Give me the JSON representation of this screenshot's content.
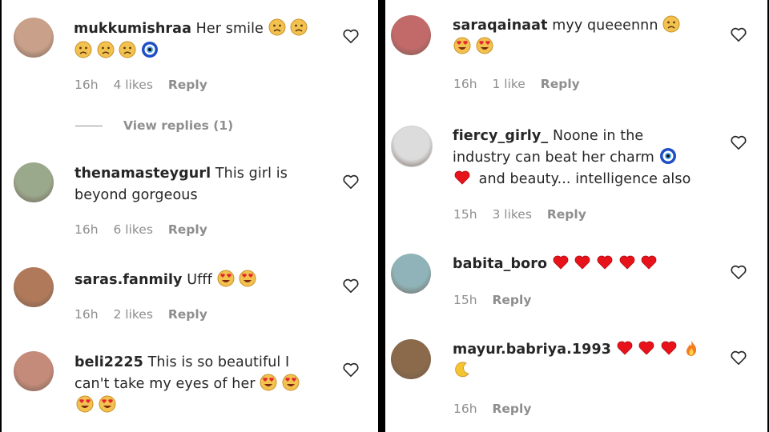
{
  "left": [
    {
      "username": "mukkumishraa",
      "text": "Her smile",
      "emojis_line1": [
        "sad-face",
        "sad-face"
      ],
      "emojis_line2": [
        "sad-face",
        "sad-face",
        "sad-face",
        "nazar-amulet"
      ],
      "time": "16h",
      "likes": "4 likes",
      "reply": "Reply",
      "view_replies": "View replies (1)",
      "avatar_color": "#c9a08a"
    },
    {
      "username": "thenamasteygurl",
      "text_line1": "This girl is",
      "text_line2": "beyond gorgeous",
      "time": "16h",
      "likes": "6 likes",
      "reply": "Reply",
      "avatar_color": "#9aa88c"
    },
    {
      "username": "saras.fanmily",
      "text": "Ufff",
      "emojis": [
        "heart-eyes",
        "heart-eyes"
      ],
      "time": "16h",
      "likes": "2 likes",
      "reply": "Reply",
      "avatar_color": "#b07a5a"
    },
    {
      "username": "beli2225",
      "text_line1": "This is so beautiful I",
      "text_line2": "can't take my eyes of her",
      "emojis_line2": [
        "heart-eyes",
        "heart-eyes"
      ],
      "emojis_line3": [
        "heart-eyes",
        "heart-eyes"
      ],
      "avatar_color": "#c48b7a"
    }
  ],
  "right": [
    {
      "username": "saraqainaat",
      "text": "myy queeennn",
      "emojis_line1": [
        "sad-face"
      ],
      "emojis_line2": [
        "heart-eyes",
        "heart-eyes"
      ],
      "time": "16h",
      "likes": "1 like",
      "reply": "Reply",
      "avatar_color": "#c26a6a"
    },
    {
      "username": "fiercy_girly_",
      "text_line1": "Noone in the",
      "text_line2": "industry can beat her charm",
      "text_line3": "and beauty... intelligence also",
      "emojis_line2": [
        "nazar-amulet"
      ],
      "emojis_line3": [
        "red-heart"
      ],
      "time": "15h",
      "likes": "3 likes",
      "reply": "Reply",
      "avatar_color": "#dcdcdc"
    },
    {
      "username": "babita_boro",
      "emojis": [
        "red-heart",
        "red-heart",
        "red-heart",
        "red-heart",
        "red-heart"
      ],
      "time": "15h",
      "reply": "Reply",
      "avatar_color": "#8fb3b8"
    },
    {
      "username": "mayur.babriya.1993",
      "emojis_line1": [
        "red-heart",
        "red-heart",
        "red-heart",
        "fire"
      ],
      "emojis_line2": [
        "crescent-moon"
      ],
      "time": "16h",
      "reply": "Reply",
      "avatar_color": "#8a6a4a"
    }
  ],
  "colors": {
    "username": "#262626",
    "meta": "#8e8e8e",
    "heart_red": "#e8121b",
    "emoji_yellow": "#f4c542"
  }
}
